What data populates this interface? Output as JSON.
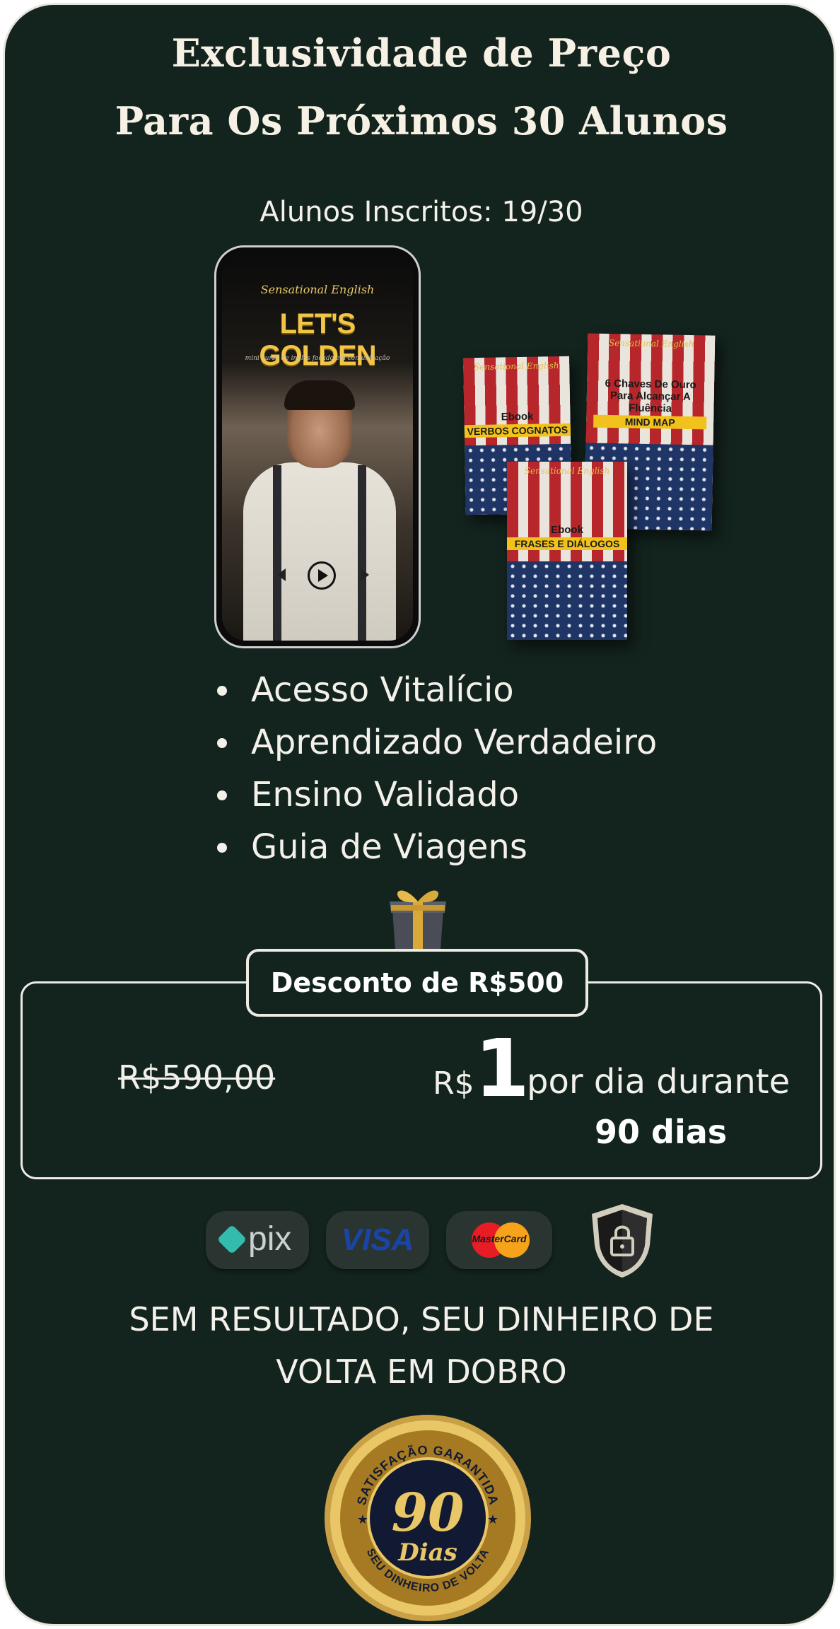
{
  "header": {
    "title_line1": "Exclusividade de Preço",
    "title_line2": "Para Os Próximos 30 Alunos",
    "enrolled": "Alunos Inscritos: 19/30"
  },
  "product": {
    "phone_brand": "Sensational English",
    "phone_title": "LET'S GOLDEN",
    "phone_subtitle": "mini curso de inglês focado em comunicação",
    "books": [
      {
        "brand": "Sensational English",
        "line1": "Ebook",
        "band": "VERBOS COGNATOS"
      },
      {
        "brand": "Sensational English",
        "line1": "6 Chaves De Ouro Para Alcançar A Fluência",
        "band": "MIND MAP"
      },
      {
        "brand": "Sensational English",
        "line1": "Ebook",
        "band": "FRASES E DIÁLOGOS"
      }
    ]
  },
  "benefits": [
    "Acesso Vitalício",
    "Aprendizado Verdadeiro",
    "Ensino Validado",
    "Guia de Viagens"
  ],
  "pricing": {
    "discount_label": "Desconto de R$500",
    "old_price": "R$590,00",
    "currency": "R$",
    "amount": "1",
    "per_day": "por dia durante",
    "duration": "90 dias"
  },
  "payment": {
    "methods": [
      "pix",
      "VISA",
      "MasterCard"
    ],
    "icons": [
      "pix-icon",
      "visa-icon",
      "mastercard-icon",
      "secure-lock-icon"
    ]
  },
  "guarantee": {
    "line1": "SEM RESULTADO, SEU DINHEIRO DE",
    "line2": "VOLTA EM DOBRO",
    "seal_top": "SATISFAÇÃO GARANTIDA",
    "seal_number": "90",
    "seal_word": "Dias",
    "seal_bottom": "SEU DINHEIRO DE VOLTA"
  },
  "colors": {
    "background": "#13231e",
    "text": "#f3f1ea",
    "gold": "#d9a93a",
    "border": "#ecebe4"
  }
}
